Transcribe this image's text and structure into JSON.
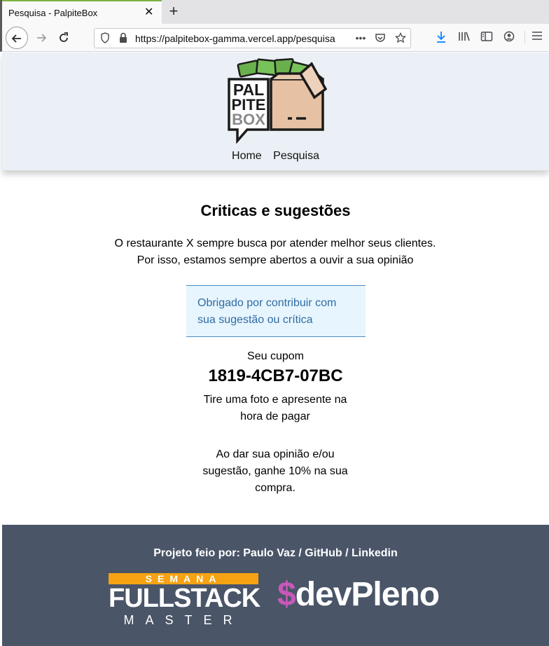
{
  "browser": {
    "tab_title": "Pesquisa - PalpiteBox",
    "tab_close": "✕",
    "new_tab": "+",
    "url": "https://palpitebox-gamma.vercel.app/pesquisa",
    "icons": [
      "back-icon",
      "forward-icon",
      "reload-icon",
      "shield-icon",
      "lock-icon",
      "more-icon",
      "pocket-icon",
      "star-icon",
      "download-icon",
      "library-icon",
      "sidebar-icon",
      "account-icon",
      "menu-icon"
    ]
  },
  "header": {
    "logo_text": [
      "PAL",
      "PITE",
      "BOX"
    ],
    "nav": [
      "Home",
      "Pesquisa"
    ]
  },
  "main": {
    "title": "Criticas e sugestões",
    "intro_line1": "O restaurante X sempre busca por atender melhor seus clientes.",
    "intro_line2": "Por isso, estamos sempre abertos a ouvir a sua opinião",
    "alert": "Obrigado por contribuir com sua sugestão ou crítica",
    "coupon_label": "Seu cupom",
    "coupon_code": "1819-4CB7-07BC",
    "coupon_hint": "Tire uma foto e apresente na hora de pagar",
    "promo": "Ao dar sua opinião e/ou sugestão, ganhe 10% na sua compra."
  },
  "footer": {
    "credits_prefix": "Projeto feio por: ",
    "author": "Paulo Vaz",
    "sep1": " / ",
    "github": "GitHub",
    "sep2": " / ",
    "linkedin": "Linkedin",
    "fsm_semana": "SEMANA",
    "fsm_fullstack": "FULLSTACK",
    "fsm_master": "MASTER",
    "devpleno_dollar": "$",
    "devpleno_text": "devPleno"
  },
  "colors": {
    "header_bg": "#eaf0f5",
    "footer_bg": "#4a5568",
    "alert_bg": "#e7f5fe",
    "alert_text": "#2f6ca3",
    "fsm_orange": "#f6a213",
    "devpleno_purple": "#c659b8"
  }
}
